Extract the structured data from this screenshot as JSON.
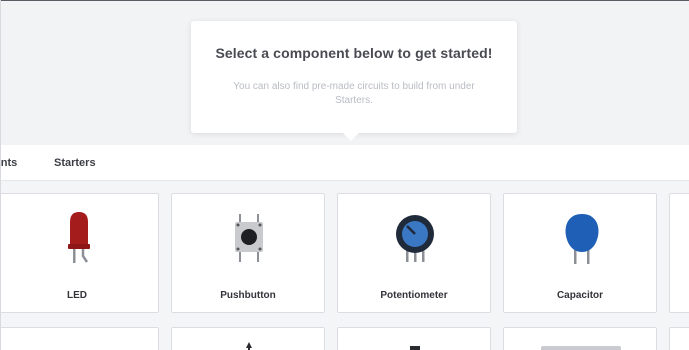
{
  "tooltip": {
    "title": "Select a component below to get started!",
    "subtitle": "You can also find pre-made circuits to build from under Starters."
  },
  "tabs": [
    {
      "label": "Components"
    },
    {
      "label": "Starters"
    }
  ],
  "components": [
    {
      "label": "LED",
      "icon": "led-icon"
    },
    {
      "label": "Pushbutton",
      "icon": "pushbutton-icon"
    },
    {
      "label": "Potentiometer",
      "icon": "potentiometer-icon"
    },
    {
      "label": "Capacitor",
      "icon": "capacitor-icon"
    }
  ],
  "colors": {
    "led": "#a51c1c",
    "potentiometer_dial": "#3a78c4",
    "capacitor": "#1f5fb6"
  }
}
